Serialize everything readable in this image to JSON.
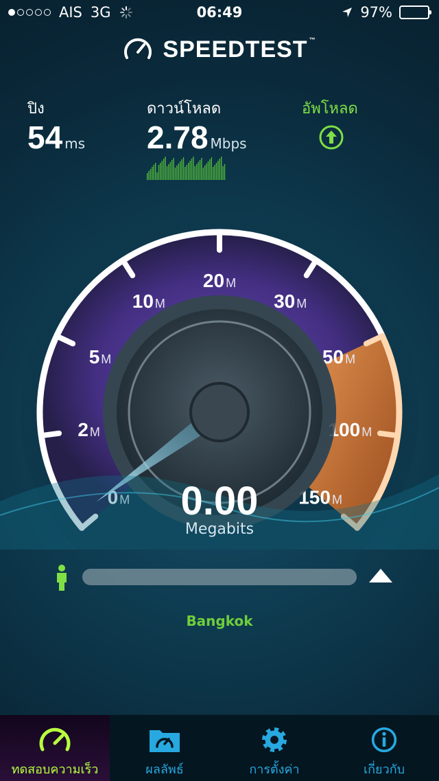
{
  "status_bar": {
    "signal_dots_filled": 1,
    "signal_dots_total": 5,
    "carrier": "AIS",
    "network": "3G",
    "time": "06:49",
    "battery_percent": "97%",
    "battery_level": 0.97
  },
  "brand": {
    "name": "SPEEDTEST",
    "trademark": "™"
  },
  "metrics": {
    "ping": {
      "label": "ปิง",
      "value": "54",
      "unit": "ms"
    },
    "download": {
      "label": "ดาวน์โหลด",
      "value": "2.78",
      "unit": "Mbps"
    },
    "upload": {
      "label": "อัพโหลด",
      "icon": "arrow-up-circle-icon"
    }
  },
  "gauge": {
    "ticks": [
      {
        "value": "0",
        "unit": "M"
      },
      {
        "value": "2",
        "unit": "M"
      },
      {
        "value": "5",
        "unit": "M"
      },
      {
        "value": "10",
        "unit": "M"
      },
      {
        "value": "20",
        "unit": "M"
      },
      {
        "value": "30",
        "unit": "M"
      },
      {
        "value": "50",
        "unit": "M"
      },
      {
        "value": "100",
        "unit": "M"
      },
      {
        "value": "150",
        "unit": "M"
      }
    ],
    "needle_value": 0.0,
    "colors": {
      "arc": "#6b3fb4",
      "highlight": "#e27a2c",
      "needle": "#9fe6ff"
    }
  },
  "speed": {
    "value": "0.00",
    "unit": "Megabits"
  },
  "progress": {
    "fraction": 0.0
  },
  "server": {
    "location": "Bangkok"
  },
  "tabs": [
    {
      "label": "ทดสอบความเร็ว",
      "icon": "speedometer-icon",
      "active": true
    },
    {
      "label": "ผลลัพธ์",
      "icon": "results-folder-icon",
      "active": false
    },
    {
      "label": "การตั้งค่า",
      "icon": "gear-icon",
      "active": false
    },
    {
      "label": "เกี่ยวกับ",
      "icon": "info-icon",
      "active": false
    }
  ]
}
